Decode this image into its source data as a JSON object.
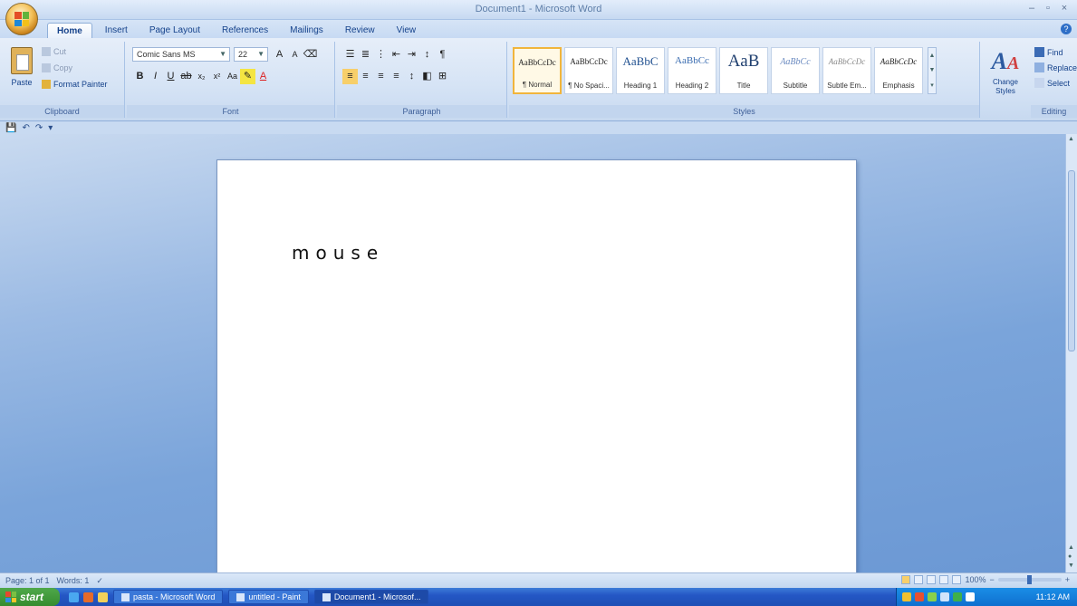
{
  "window": {
    "title": "Document1 - Microsoft Word"
  },
  "window_controls": [
    "–",
    "▫",
    "×"
  ],
  "tabs": [
    "Home",
    "Insert",
    "Page Layout",
    "References",
    "Mailings",
    "Review",
    "View"
  ],
  "clipboard": {
    "paste": "Paste",
    "cut": "Cut",
    "copy": "Copy",
    "format_painter": "Format Painter",
    "label": "Clipboard"
  },
  "font": {
    "name": "Comic Sans MS",
    "size": "22",
    "label": "Font"
  },
  "paragraph": {
    "label": "Paragraph"
  },
  "styles": {
    "label": "Styles",
    "items": [
      {
        "sample": "AaBbCcDc",
        "name": "¶ Normal"
      },
      {
        "sample": "AaBbCcDc",
        "name": "¶ No Spaci..."
      },
      {
        "sample": "AaBbC",
        "name": "Heading 1"
      },
      {
        "sample": "AaBbCc",
        "name": "Heading 2"
      },
      {
        "sample": "AaB",
        "name": "Title"
      },
      {
        "sample": "AaBbCc",
        "name": "Subtitle"
      },
      {
        "sample": "AaBbCcDc",
        "name": "Subtle Em..."
      },
      {
        "sample": "AaBbCcDc",
        "name": "Emphasis"
      }
    ],
    "change_styles": "Change Styles"
  },
  "editing": {
    "label": "Editing",
    "find": "Find",
    "replace": "Replace",
    "select": "Select"
  },
  "document": {
    "text": "mouse"
  },
  "status": {
    "page": "Page: 1 of 1",
    "words": "Words: 1",
    "zoom": "100%",
    "zoom_level": 0.5
  },
  "taskbar": {
    "start": "start",
    "buttons": [
      {
        "label": "pasta - Microsoft Word",
        "active": false
      },
      {
        "label": "untitled - Paint",
        "active": false
      },
      {
        "label": "Document1 - Microsof...",
        "active": true
      }
    ],
    "clock": "11:12 AM"
  },
  "colors": {
    "accent": "#15428b",
    "ribbon_bg": "#d5e3f5",
    "workspace": "#7aa4da",
    "taskbar": "#2457c5",
    "start_green": "#3f9a3a"
  }
}
